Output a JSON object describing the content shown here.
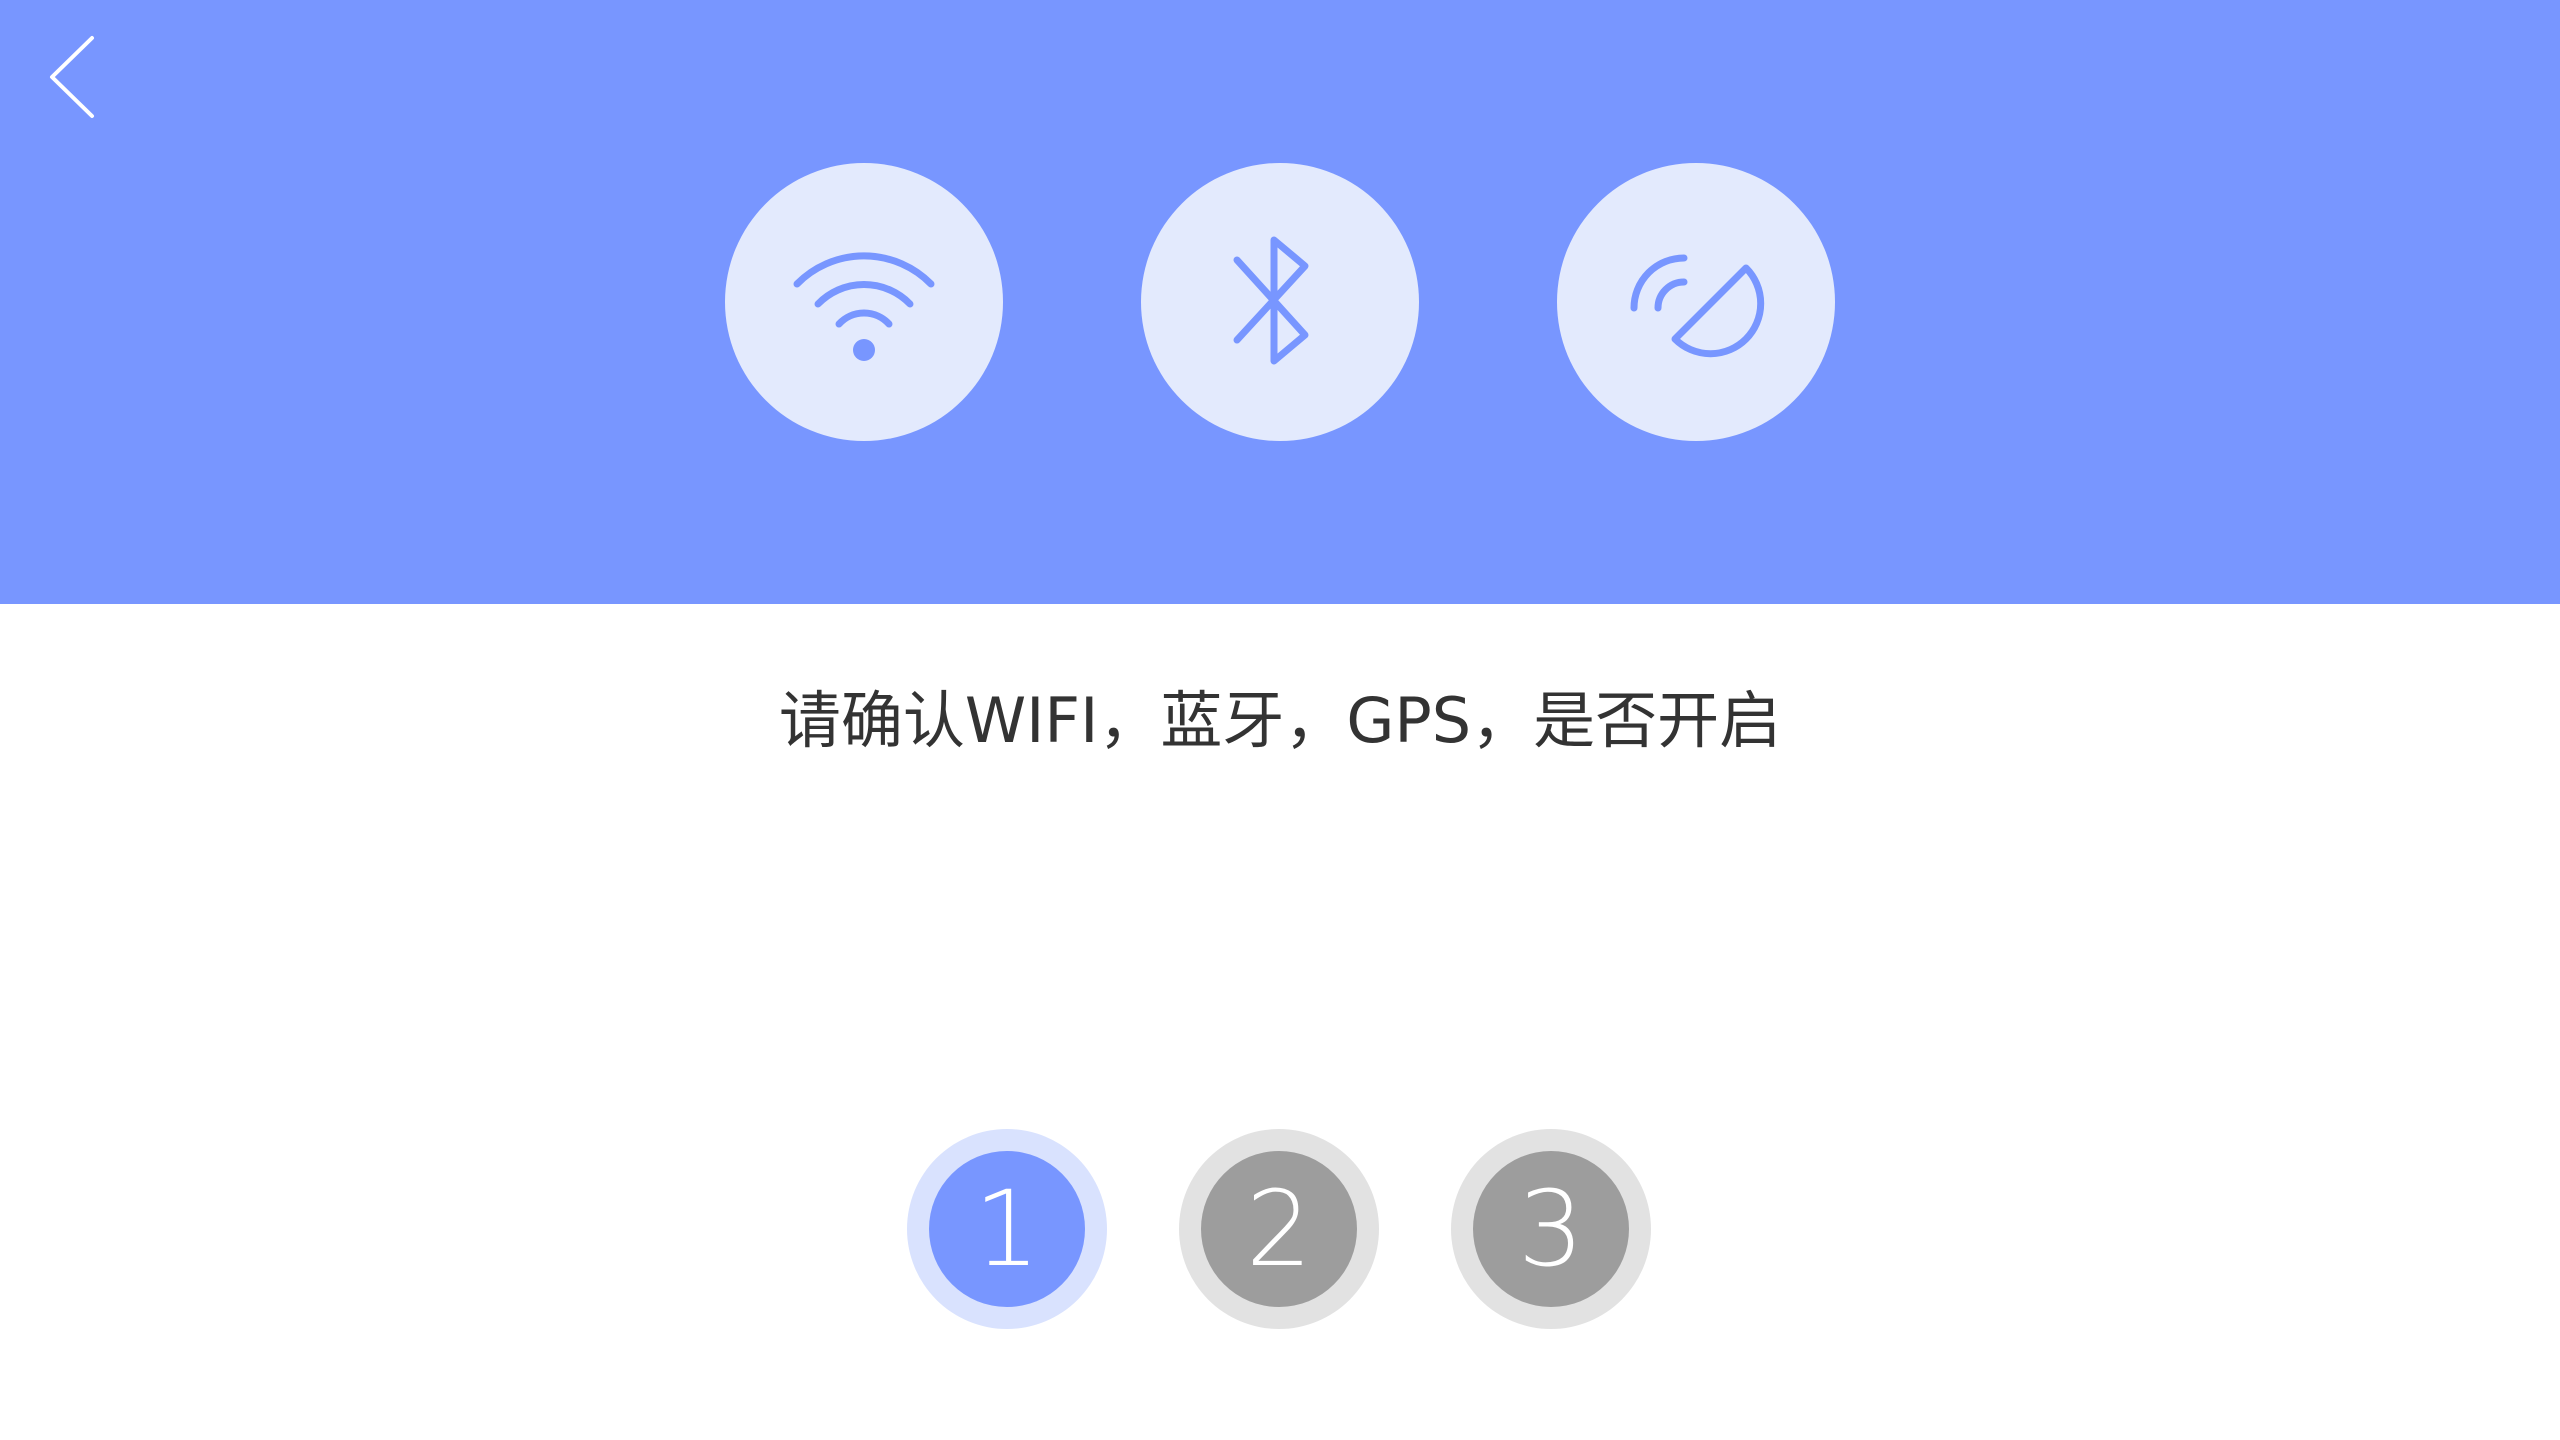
{
  "header": {
    "background": "#7896ff",
    "back_icon": "chevron-left-icon",
    "icons": [
      {
        "name": "wifi-icon"
      },
      {
        "name": "bluetooth-icon"
      },
      {
        "name": "gps-icon"
      }
    ]
  },
  "instruction": {
    "text": "请确认WIFI，蓝牙，GPS，是否开启"
  },
  "steps": [
    {
      "label": "1",
      "state": "active"
    },
    {
      "label": "2",
      "state": "inactive"
    },
    {
      "label": "3",
      "state": "inactive"
    }
  ],
  "colors": {
    "accent": "#7896ff",
    "icon_bg": "#e3eafd",
    "step_inactive": "#9d9d9d",
    "step_inactive_ring": "#e2e2e2",
    "step_active_ring": "#d9e2fe",
    "text": "#333333"
  }
}
